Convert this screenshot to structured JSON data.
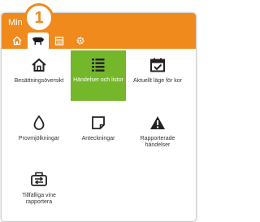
{
  "header": {
    "title": "Min"
  },
  "badge": {
    "number": "1"
  },
  "nav": {
    "tabs": [
      {
        "icon": "home-icon"
      },
      {
        "icon": "cow-icon",
        "active": true
      },
      {
        "icon": "calendar-icon"
      },
      {
        "icon": "settings-icon"
      }
    ]
  },
  "colors": {
    "header_orange": "#f08a1d",
    "active_green": "#74b72a"
  },
  "menu": {
    "items": [
      {
        "label": "Besättningsöversikt",
        "icon": "home-icon"
      },
      {
        "label": "Händelser och listor",
        "icon": "list-icon",
        "active": true
      },
      {
        "label": "Aktuellt läge för kor",
        "icon": "calendar-check-icon"
      },
      {
        "label": "Provmjölkningar",
        "icon": "drop-icon"
      },
      {
        "label": "Anteckningar",
        "icon": "note-icon"
      },
      {
        "label": "Rapporterade händelser",
        "icon": "warning-icon"
      },
      {
        "label": "Tillfälliga vine rapportera",
        "icon": "transfer-icon"
      }
    ]
  }
}
